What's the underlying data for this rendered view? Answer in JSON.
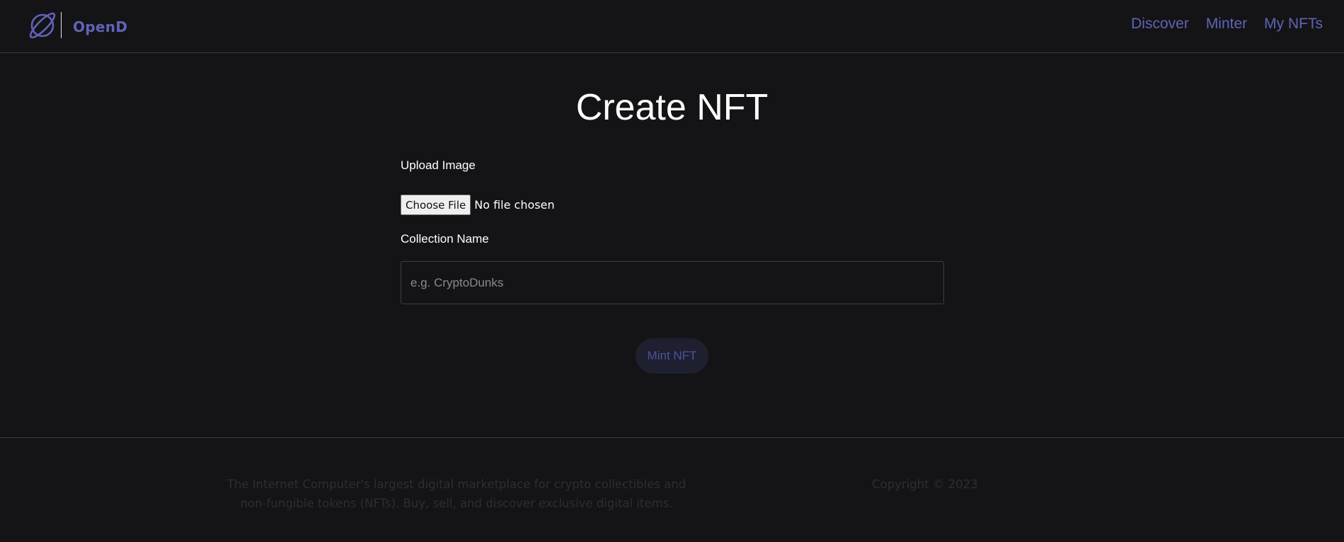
{
  "header": {
    "brand": "OpenD",
    "logo_icon": "planet-icon",
    "nav": [
      {
        "label": "Discover"
      },
      {
        "label": "Minter"
      },
      {
        "label": "My NFTs"
      }
    ]
  },
  "main": {
    "title": "Create NFT",
    "upload_label": "Upload Image",
    "file_button": "Choose File",
    "file_status": "No file chosen",
    "collection_label": "Collection Name",
    "collection_placeholder": "e.g. CryptoDunks",
    "collection_value": "",
    "mint_button": "Mint NFT"
  },
  "footer": {
    "description": "The Internet Computer's largest digital marketplace for crypto collectibles and non-fungible tokens (NFTs). Buy, sell, and discover exclusive digital items.",
    "copyright": "Copyright © 2023"
  },
  "colors": {
    "background": "#141416",
    "accent": "#5f63b8",
    "divider": "#3a3a3e"
  }
}
